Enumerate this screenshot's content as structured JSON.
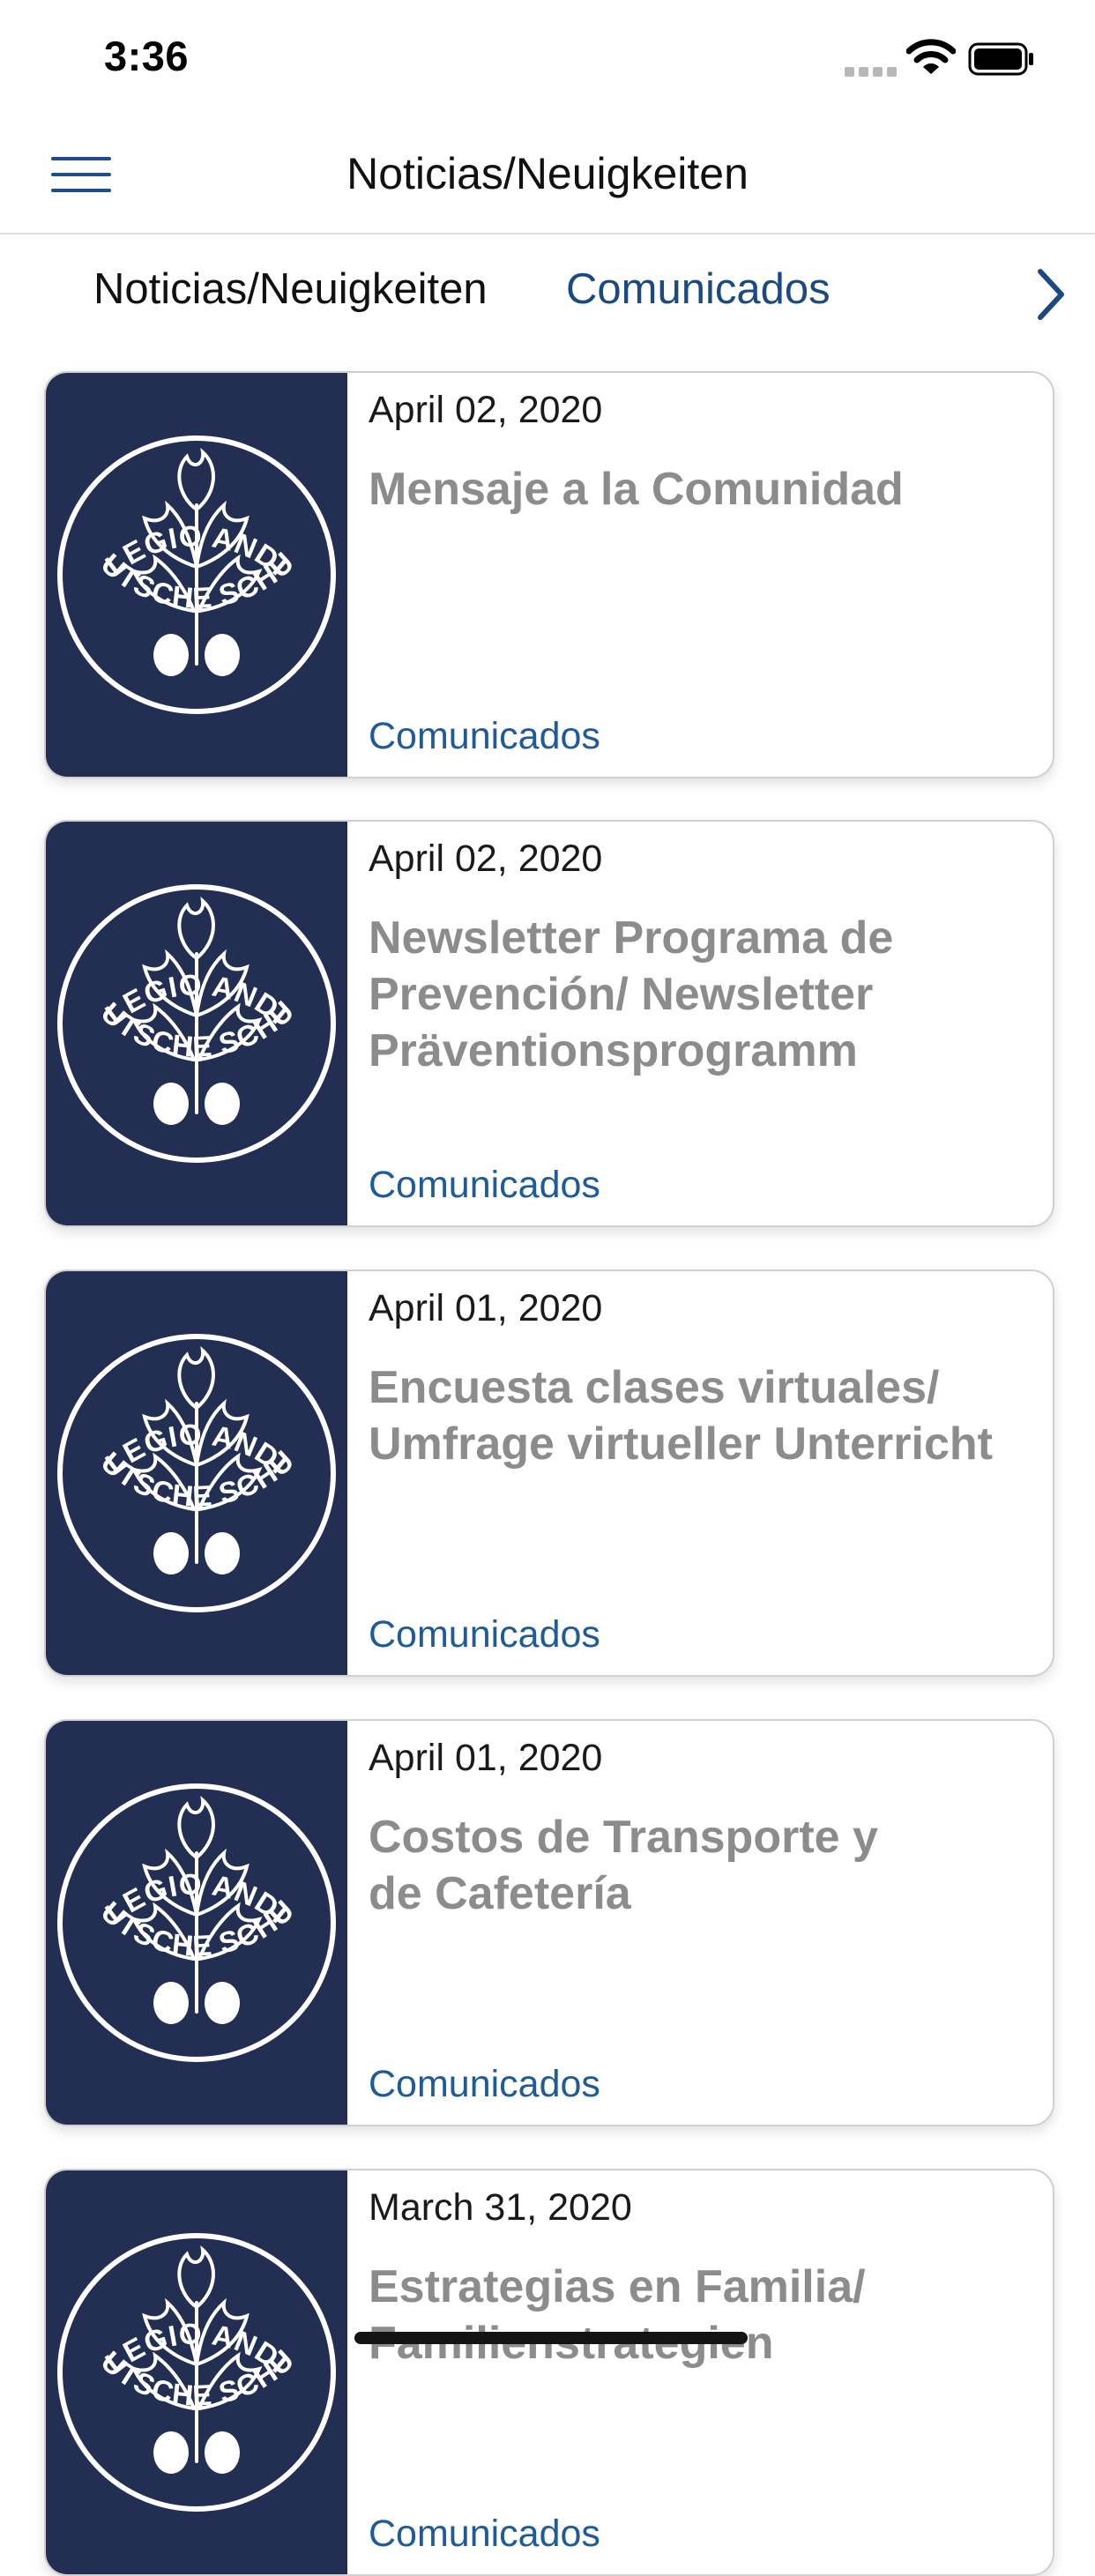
{
  "status_bar": {
    "time": "3:36"
  },
  "nav": {
    "title": "Noticias/Neuigkeiten"
  },
  "tabs": [
    {
      "label": "Noticias/Neuigkeiten"
    },
    {
      "label": "Comunicados"
    }
  ],
  "logo": {
    "top_text": "COLEGIO ANDINO",
    "bottom_text": "DEUTSCHE SCHULE"
  },
  "cards": [
    {
      "date": "April 02, 2020",
      "title_lines": [
        "Mensaje a la Comunidad"
      ],
      "category": "Comunicados"
    },
    {
      "date": "April 02, 2020",
      "title_lines": [
        "Newsletter Programa de",
        "Prevención/ Newsletter",
        "Präventionsprogramm"
      ],
      "category": "Comunicados"
    },
    {
      "date": "April 01, 2020",
      "title_lines": [
        "Encuesta clases virtuales/",
        "Umfrage virtueller Unterricht"
      ],
      "category": "Comunicados"
    },
    {
      "date": "April 01, 2020",
      "title_lines": [
        "Costos de Transporte y",
        "de Cafetería"
      ],
      "category": "Comunicados"
    },
    {
      "date": "March 31, 2020",
      "title_lines": [
        "Estrategias en Familia/",
        "Familienstrategien"
      ],
      "category": "Comunicados"
    }
  ]
}
